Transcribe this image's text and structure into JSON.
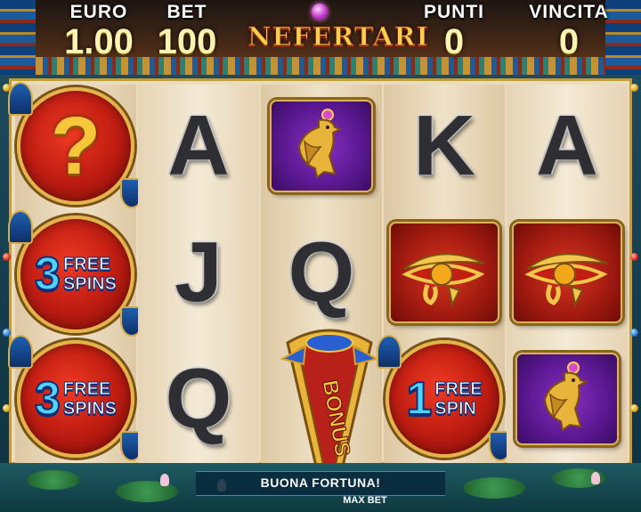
{
  "header": {
    "currency_label": "EURO",
    "currency_value": "1.00",
    "bet_label": "BET",
    "bet_value": "100",
    "points_label": "PUNTI",
    "points_value": "0",
    "win_label": "VINCITA",
    "win_value": "0",
    "logo": "NEFERTARI"
  },
  "reels": [
    [
      {
        "symbol": "mystery-question",
        "text": "?"
      },
      {
        "symbol": "free-spins",
        "count": "3",
        "line1": "FREE",
        "line2": "SPINS"
      },
      {
        "symbol": "free-spins",
        "count": "3",
        "line1": "FREE",
        "line2": "SPINS"
      }
    ],
    [
      {
        "symbol": "letter-a",
        "text": "A"
      },
      {
        "symbol": "letter-j",
        "text": "J"
      },
      {
        "symbol": "letter-q",
        "text": "Q"
      }
    ],
    [
      {
        "symbol": "golden-falcon"
      },
      {
        "symbol": "letter-q",
        "text": "Q"
      },
      {
        "symbol": "bonus-scarab",
        "text": "BONUS"
      }
    ],
    [
      {
        "symbol": "letter-k",
        "text": "K"
      },
      {
        "symbol": "eye-of-horus"
      },
      {
        "symbol": "free-spins",
        "count": "1",
        "line1": "FREE",
        "line2": "SPIN"
      }
    ],
    [
      {
        "symbol": "letter-a",
        "text": "A"
      },
      {
        "symbol": "eye-of-horus"
      },
      {
        "symbol": "golden-falcon"
      }
    ]
  ],
  "footer": {
    "message": "BUONA FORTUNA!",
    "max_bet_label": "MAX BET"
  },
  "colors": {
    "gold": "#f7c63a",
    "reel_bg": "#f4ead6",
    "disc_red": "#c01d12",
    "tile_purple": "#5a1890",
    "free_spin_blue": "#4fd4ff"
  }
}
